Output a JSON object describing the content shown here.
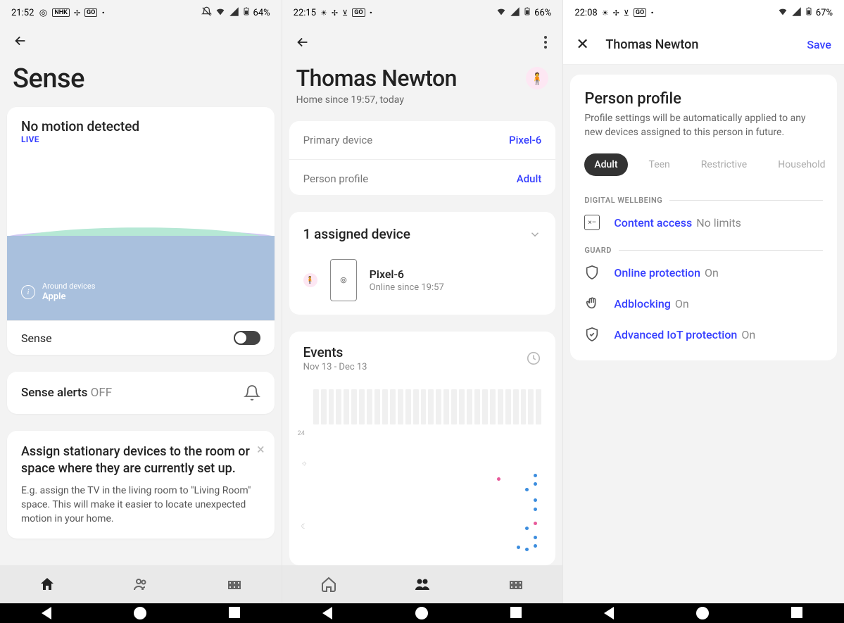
{
  "screen1": {
    "status": {
      "time": "21:52",
      "battery": "64%"
    },
    "header": {
      "title": "Sense"
    },
    "motion": {
      "title": "No motion detected",
      "live": "LIVE",
      "around_label": "Around devices",
      "around_value": "Apple"
    },
    "sense_row": {
      "label": "Sense"
    },
    "alerts": {
      "label": "Sense alerts",
      "state": "OFF"
    },
    "tip": {
      "title": "Assign stationary devices to the room or space where they are currently set up.",
      "body": "E.g. assign the TV in the living room to \"Living Room\" space. This will make it easier to locate unexpected motion in your home."
    }
  },
  "screen2": {
    "status": {
      "time": "22:15",
      "battery": "66%"
    },
    "title": "Thomas Newton",
    "subtitle": "Home since 19:57, today",
    "primary_device": {
      "label": "Primary device",
      "value": "Pixel-6"
    },
    "profile": {
      "label": "Person profile",
      "value": "Adult"
    },
    "assigned": {
      "title": "1 assigned device"
    },
    "device": {
      "name": "Pixel-6",
      "sub": "Online since 19:57"
    },
    "events": {
      "title": "Events",
      "range": "Nov 13 - Dec 13",
      "yaxis_top": "24"
    }
  },
  "screen3": {
    "status": {
      "time": "22:08",
      "battery": "67%"
    },
    "appbar": {
      "title": "Thomas Newton",
      "save": "Save"
    },
    "profile": {
      "heading": "Person profile",
      "desc": "Profile settings will be automatically applied to any new devices assigned to this person in future."
    },
    "chips": {
      "adult": "Adult",
      "teen": "Teen",
      "restrictive": "Restrictive",
      "household": "Household"
    },
    "sections": {
      "wellbeing": "DIGITAL WELLBEING",
      "guard": "GUARD"
    },
    "settings": {
      "content": {
        "label": "Content access",
        "value": "No limits"
      },
      "online": {
        "label": "Online protection",
        "value": "On"
      },
      "adblock": {
        "label": "Adblocking",
        "value": "On"
      },
      "iot": {
        "label": "Advanced IoT protection",
        "value": "On"
      }
    }
  }
}
